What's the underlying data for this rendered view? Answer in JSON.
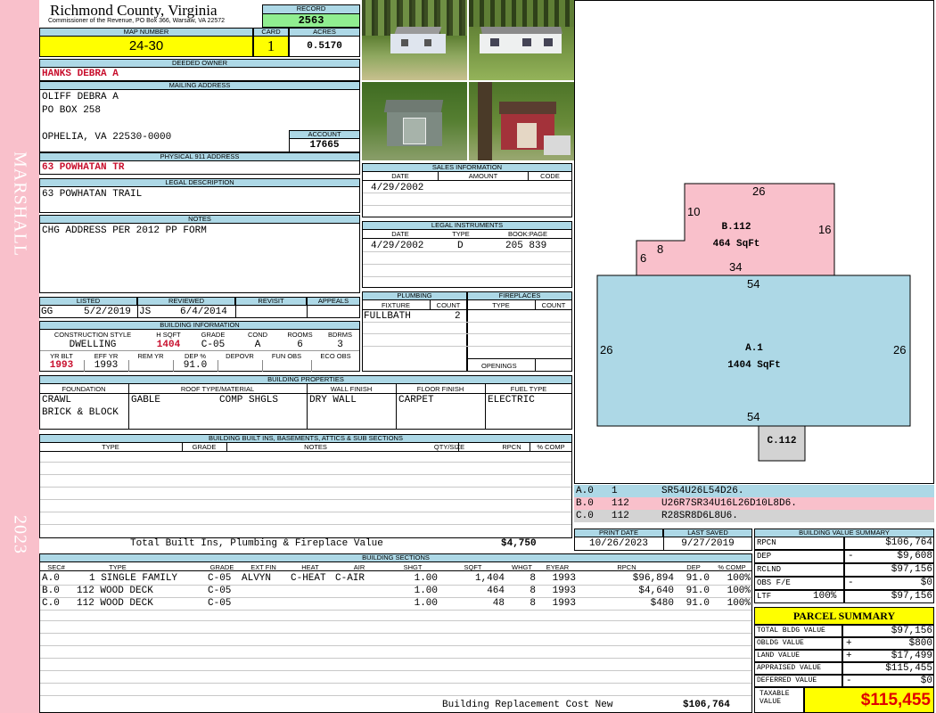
{
  "side": {
    "district": "MARSHALL",
    "year": "2023"
  },
  "header": {
    "county": "Richmond County, Virginia",
    "commissioner": "Commissioner of the Revenue, PO Box 366, Warsaw, VA 22572",
    "record_label": "RECORD",
    "record": "2563",
    "map_label": "MAP NUMBER",
    "map": "24-30",
    "card_label": "CARD",
    "card": "1",
    "acres_label": "ACRES",
    "acres": "0.5170"
  },
  "owner": {
    "deeded_label": "DEEDED OWNER",
    "deeded": "HANKS DEBRA A",
    "mailing_label": "MAILING ADDRESS",
    "mailing": [
      "OLIFF DEBRA A",
      "PO BOX 258",
      "",
      "OPHELIA, VA 22530-0000"
    ],
    "account_label": "ACCOUNT",
    "account": "17665",
    "address911_label": "PHYSICAL 911 ADDRESS",
    "address911": "63 POWHATAN TR"
  },
  "legal": {
    "label": "LEGAL DESCRIPTION",
    "value": "63 POWHATAN TRAIL"
  },
  "notes": {
    "label": "NOTES",
    "value": "CHG ADDRESS PER 2012 PP FORM"
  },
  "sales": {
    "label": "SALES INFORMATION",
    "cols": [
      "DATE",
      "AMOUNT",
      "CODE"
    ],
    "rows": [
      {
        "date": "4/29/2002",
        "amount": "",
        "code": ""
      }
    ]
  },
  "instruments": {
    "label": "LEGAL INSTRUMENTS",
    "cols": [
      "DATE",
      "TYPE",
      "BOOK:PAGE"
    ],
    "rows": [
      {
        "date": "4/29/2002",
        "type": "D",
        "book": "205 839"
      }
    ]
  },
  "review": {
    "cols": [
      "LISTED",
      "REVIEWED",
      "REVISIT",
      "APPEALS"
    ],
    "listed_by": "GG",
    "listed": "5/2/2019",
    "reviewed_by": "JS",
    "reviewed": "6/4/2014"
  },
  "building_info": {
    "label": "BUILDING INFORMATION",
    "cols1": [
      "CONSTRUCTION STYLE",
      "H SQFT",
      "GRADE",
      "COND",
      "ROOMS",
      "BDRMS"
    ],
    "style": "DWELLING",
    "hsqft": "1404",
    "grade": "C-05",
    "cond": "A",
    "rooms": "6",
    "bdrms": "3",
    "cols2": [
      "YR BLT",
      "EFF YR",
      "REM YR",
      "DEP %",
      "DEPOVR",
      "FUN OBS",
      "ECO OBS"
    ],
    "yrblt": "1993",
    "effyr": "1993",
    "dep": "91.0"
  },
  "plumbing": {
    "label": "PLUMBING",
    "cols": [
      "FIXTURE",
      "COUNT"
    ],
    "rows": [
      {
        "fixture": "FULLBATH",
        "count": "2"
      }
    ]
  },
  "fireplaces": {
    "label": "FIREPLACES",
    "cols": [
      "TYPE",
      "COUNT"
    ],
    "openings": "OPENINGS"
  },
  "properties": {
    "label": "BUILDING PROPERTIES",
    "cols": [
      "FOUNDATION",
      "ROOF TYPE/MATERIAL",
      "WALL FINISH",
      "FLOOR FINISH",
      "FUEL TYPE"
    ],
    "foundation": [
      "CRAWL",
      "BRICK & BLOCK"
    ],
    "roof_type": "GABLE",
    "roof_material": "COMP SHGLS",
    "wall": "DRY WALL",
    "floor": "CARPET",
    "fuel": "ELECTRIC"
  },
  "builtins": {
    "label": "BUILDING BUILT INS, BASEMENTS, ATTICS & SUB SECTIONS",
    "cols": [
      "TYPE",
      "GRADE",
      "NOTES",
      "QTY/SIZE",
      "RPCN",
      "% COMP"
    ],
    "total_label": "Total Built Ins, Plumbing & Fireplace Value",
    "total": "$4,750"
  },
  "dates": {
    "print_label": "PRINT DATE",
    "print": "10/26/2023",
    "saved_label": "LAST SAVED",
    "saved": "9/27/2019"
  },
  "sections": {
    "label": "BUILDING SECTIONS",
    "cols": [
      "SEC#",
      "TYPE",
      "GRADE",
      "EXT FIN",
      "HEAT",
      "AIR",
      "SHGT",
      "SQFT",
      "WHGT",
      "EYEAR",
      "RPCN",
      "DEP",
      "% COMP"
    ],
    "rows": [
      {
        "sec": "A.0",
        "type": "1 SINGLE FAMILY",
        "grade": "C-05",
        "ext": "ALVYN",
        "heat": "C-HEAT",
        "air": "C-AIR",
        "shgt": "1.00",
        "sqft": "1,404",
        "whgt": "8",
        "eyear": "1993",
        "rpcn": "$96,894",
        "dep": "91.0",
        "comp": "100%"
      },
      {
        "sec": "B.0",
        "type": "112 WOOD DECK",
        "grade": "C-05",
        "ext": "",
        "heat": "",
        "air": "",
        "shgt": "1.00",
        "sqft": "464",
        "whgt": "8",
        "eyear": "1993",
        "rpcn": "$4,640",
        "dep": "91.0",
        "comp": "100%"
      },
      {
        "sec": "C.0",
        "type": "112 WOOD DECK",
        "grade": "C-05",
        "ext": "",
        "heat": "",
        "air": "",
        "shgt": "1.00",
        "sqft": "48",
        "whgt": "8",
        "eyear": "1993",
        "rpcn": "$480",
        "dep": "91.0",
        "comp": "100%"
      }
    ],
    "replacement_label": "Building Replacement Cost New",
    "replacement": "$106,764"
  },
  "sketch": {
    "b_label": "B.112",
    "b_area": "464 SqFt",
    "b_top": "26",
    "b_right": "16",
    "b_left": "10",
    "b_notch_w": "8",
    "b_notch_h": "6",
    "b_bottom": "34",
    "a_label": "A.1",
    "a_area": "1404 SqFt",
    "a_top": "54",
    "a_bottom": "54",
    "a_left": "26",
    "a_right": "26",
    "c_label": "C.112",
    "vectors": [
      {
        "sec": "A.0",
        "num": "1",
        "code": "SR54U26L54D26.",
        "color": "#add8e6"
      },
      {
        "sec": "B.0",
        "num": "112",
        "code": "U26R7SR34U16L26D10L8D6.",
        "color": "#f9c0cb"
      },
      {
        "sec": "C.0",
        "num": "112",
        "code": "R28SR8D6L8U6.",
        "color": "#d3d3d3"
      }
    ]
  },
  "value_summary": {
    "label": "BUILDING VALUE SUMMARY",
    "rows": [
      {
        "label": "RPCN",
        "sign": "",
        "pct": "",
        "value": "$106,764"
      },
      {
        "label": "DEP",
        "sign": "-",
        "pct": "",
        "value": "$9,608"
      },
      {
        "label": "RCLND",
        "sign": "",
        "pct": "",
        "value": "$97,156"
      },
      {
        "label": "OBS F/E",
        "sign": "-",
        "pct": "",
        "value": "$0"
      },
      {
        "label": "LTF",
        "sign": "",
        "pct": "100%",
        "value": "$97,156"
      }
    ]
  },
  "parcel_summary": {
    "label": "PARCEL SUMMARY",
    "rows": [
      {
        "label": "TOTAL BLDG VALUE",
        "sign": "",
        "value": "$97,156"
      },
      {
        "label": "OBLDG VALUE",
        "sign": "+",
        "value": "$800"
      },
      {
        "label": "LAND VALUE",
        "sign": "+",
        "value": "$17,499"
      },
      {
        "label": "APPRAISED VALUE",
        "sign": "",
        "value": "$115,455"
      },
      {
        "label": "DEFERRED VALUE",
        "sign": "-",
        "value": "$0"
      }
    ],
    "taxable_label": "TAXABLE VALUE",
    "taxable": "$115,455"
  },
  "colors": {
    "header": "#add8e6",
    "yellow": "#ffff00",
    "green": "#90ee90",
    "pink": "#f9c0cb",
    "red": "#c8102e"
  }
}
